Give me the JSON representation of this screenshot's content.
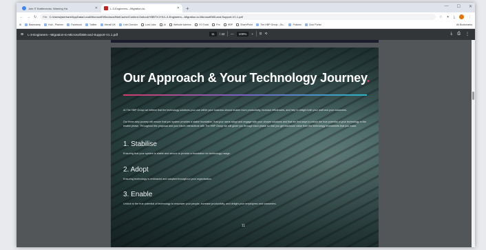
{
  "browser": {
    "tabs": [
      {
        "label": "Join IT Bottlenecks: Warning Ha",
        "active": false
      },
      {
        "label": "L-3-Engineers---Migration-to-",
        "active": true
      }
    ],
    "new_tab": "+",
    "url": "C:/Users/jsterhant/AppData/Local/Microsoft/Windows/INetCache/Content.Outlook/YBBTX1YK/L-3-Engineers---Migration-to-Microsoft365-and-Support-V1.1.pdf",
    "url_prefix": "File",
    "bookmarks": [
      "Basecamp",
      "Hub - Planner",
      "Facebook",
      "Twitter",
      "Mensil UK",
      "Link Checker",
      "Lost Labs",
      "AI",
      "Website Admins",
      "YO Tools",
      "Pro",
      "HBP",
      "SharePoint",
      "The HBP Group - Gu...",
      "Policies",
      "Club Portal"
    ],
    "all_bookmarks": "All Bookmarks"
  },
  "pdf_toolbar": {
    "filename": "L-3-Engineers---Migration-to-Microsoft365-and-Support-V1.1.pdf",
    "page_current": "11",
    "page_total": "/ 42",
    "zoom": "100%",
    "zoom_out": "—",
    "zoom_in": "+"
  },
  "page": {
    "title": "Our Approach & Your Technology Journey",
    "title_dot": ".",
    "para1": "At The HBP Group we believe that the technology solutions your use within your business should enable more productivity, increase efficiencies, and help to delight both your staff and your customers.",
    "para2": "Our three-step journey will ensure that you system provides a stable foundation, that your users adopt and engage with your chosen solutions and that we find ways to unlock the true potential of your technology in the enable phase. Throughout this proposal and your future interactions with The HBP Group we will guide you through each phase so that you get maximum value from the technology investments that you make.",
    "steps": [
      {
        "heading": "1. Stabilise",
        "text": "Ensuring that your system is stable and secure to provide a foundation for technology usage."
      },
      {
        "heading": "2. Adopt",
        "text": "Ensuring technology is embraced and adopted throughout your organisation."
      },
      {
        "heading": "3. Enable",
        "text": "Unlock to the true potential of technology to empower your people, increase productivity, and delight your employees and customers."
      }
    ],
    "page_number": "11"
  }
}
